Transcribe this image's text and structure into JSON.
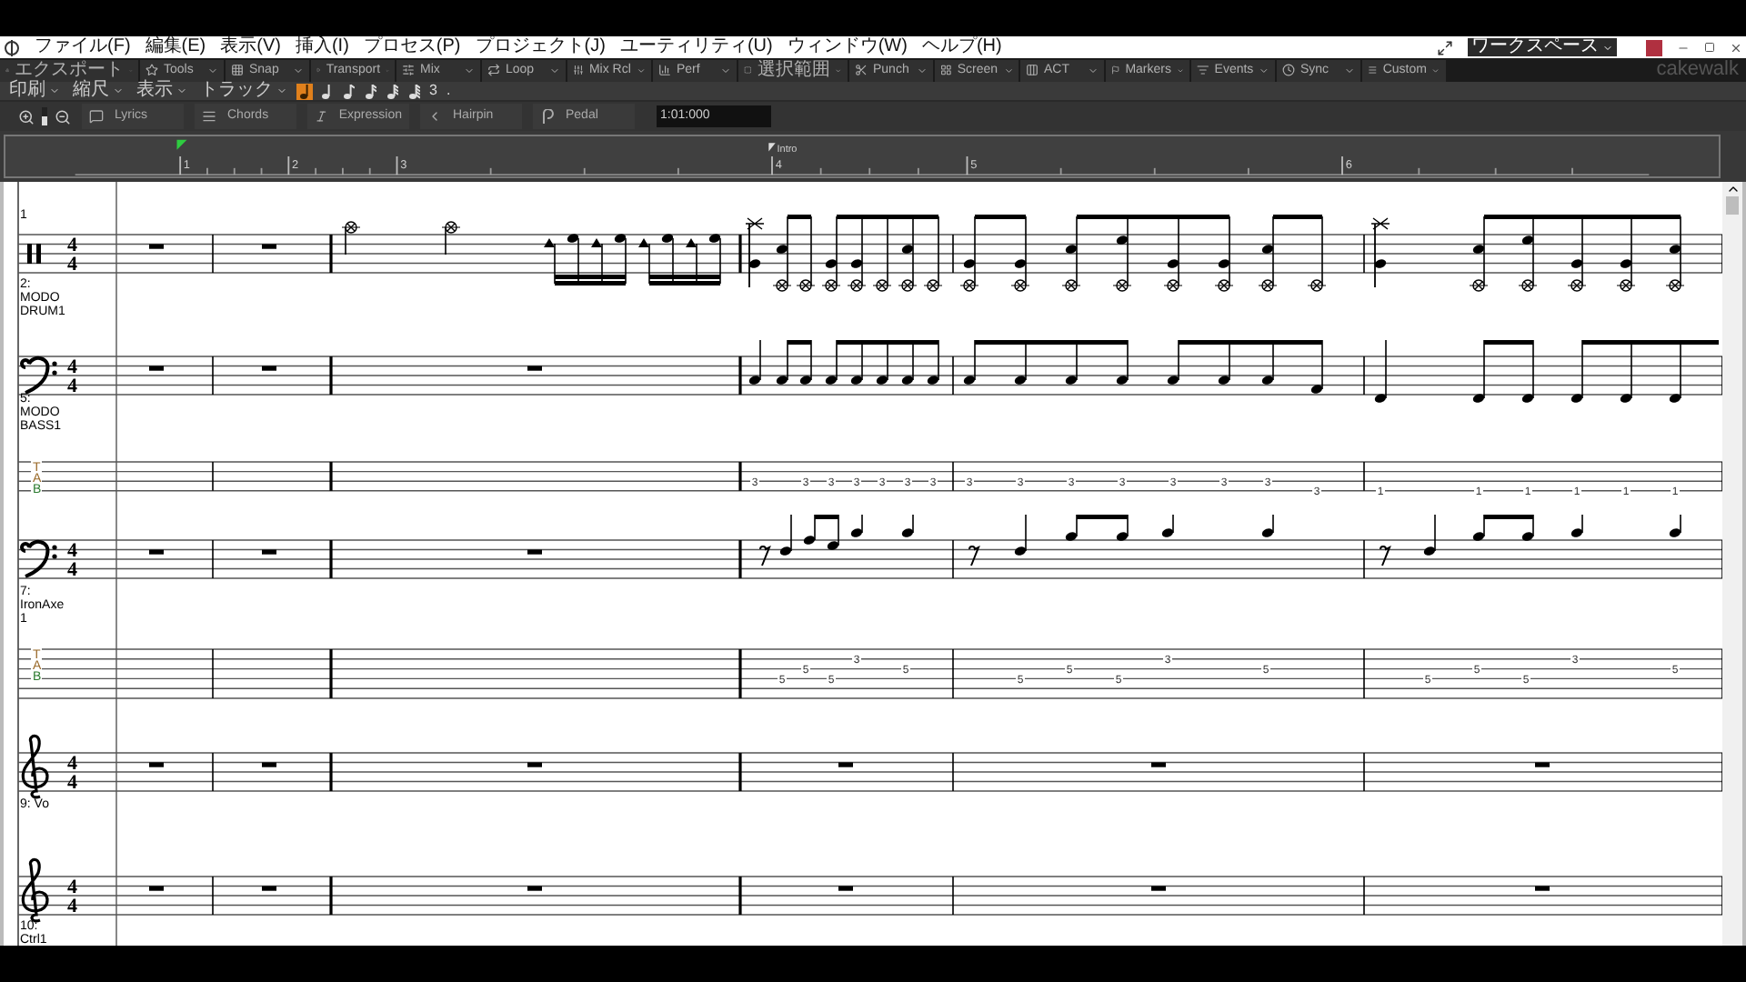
{
  "menu": [
    "ファイル(F)",
    "編集(E)",
    "表示(V)",
    "挿入(I)",
    "プロセス(P)",
    "プロジェクト(J)",
    "ユーティリティ(U)",
    "ウィンドウ(W)",
    "ヘルプ(H)"
  ],
  "workspace": {
    "value": "ワークスペース"
  },
  "toolbar": [
    "エクスポート",
    "Tools",
    "Snap",
    "Transport",
    "Mix",
    "Loop",
    "Mix Rcl",
    "Perf",
    "選択範囲",
    "Punch",
    "Screen",
    "ACT",
    "Markers",
    "Events",
    "Sync",
    "Custom"
  ],
  "logo": "cakewalk",
  "score_toolbar": {
    "menus": [
      "印刷",
      "縮尺",
      "表示",
      "トラック"
    ],
    "durations": [
      {
        "selected": true
      },
      {
        "selected": false
      },
      {
        "selected": false
      },
      {
        "selected": false
      },
      {
        "selected": false
      },
      {
        "selected": false
      }
    ],
    "tuplet": "3",
    "dot": "."
  },
  "tools": [
    "Lyrics",
    "Chords",
    "Expression",
    "Hairpin",
    "Pedal"
  ],
  "zoom": {
    "level": 0.5
  },
  "now_time": "1:01:000",
  "ruler": {
    "measures": [
      "1",
      "2",
      "3",
      "4",
      "5",
      "6"
    ],
    "marker": "Intro"
  },
  "score": {
    "system_number": "1",
    "staves": [
      {
        "kind": "percussion",
        "time_signature": [
          "4",
          "4"
        ],
        "label": [
          "2:",
          "MODO",
          "DRUM1"
        ]
      },
      {
        "kind": "bass",
        "time_signature": [
          "4",
          "4"
        ],
        "label": [
          "5:",
          "MODO",
          "BASS1"
        ]
      },
      {
        "kind": "tab",
        "letters": [
          "T",
          "A",
          "B"
        ],
        "frets": [
          "3",
          "3",
          "3",
          "3",
          "3",
          "3",
          "3",
          "3",
          "3",
          "3",
          "3",
          "3",
          "3",
          "3",
          "3",
          "1",
          "1",
          "1",
          "1",
          "1",
          "1"
        ]
      },
      {
        "kind": "bass",
        "time_signature": [
          "4",
          "4"
        ],
        "label": [
          "7:",
          "IronAxe",
          "1"
        ]
      },
      {
        "kind": "tab",
        "letters": [
          "T",
          "A",
          "B"
        ],
        "frets": [
          "5",
          "5",
          "5",
          "3",
          "5",
          "5",
          "5",
          "5",
          "3",
          "5",
          "5",
          "5",
          "5",
          "3",
          "5"
        ]
      },
      {
        "kind": "treble",
        "time_signature": [
          "4",
          "4"
        ],
        "label": [
          "9: Vo"
        ]
      },
      {
        "kind": "treble",
        "time_signature": [
          "4",
          "4"
        ],
        "label": [
          "10:",
          "Ctrl1"
        ]
      }
    ]
  }
}
